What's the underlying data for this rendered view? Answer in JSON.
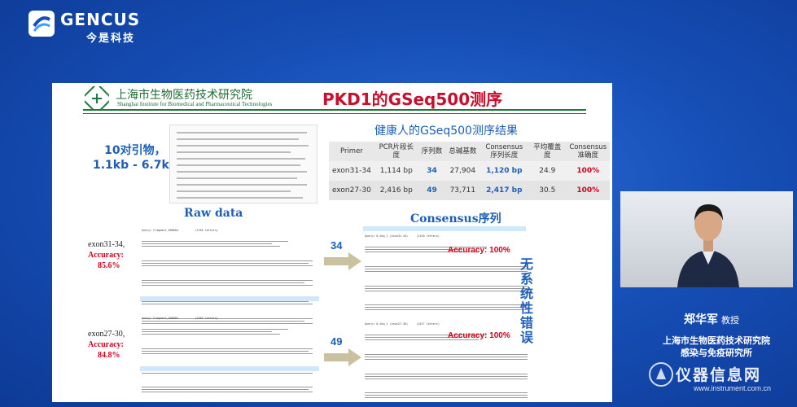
{
  "brand": {
    "name": "GENCUS",
    "sub": "今是科技"
  },
  "slide": {
    "institute_cn": "上海市生物医药技术研究院",
    "institute_en": "Shanghai Institute for Biomedical and Pharmaceutical Technologies",
    "title": "PKD1的GSeq500测序",
    "primer_text_1": "10对引物，",
    "primer_text_2": "1.1kb - 6.7kb",
    "result_title": "健康人的GSeq500测序结果",
    "table": {
      "headers": [
        "Primer",
        "PCR片段长度",
        "序列数",
        "总碱基数",
        "Consensus序列长度",
        "平均覆盖度",
        "Consensus准确度"
      ],
      "rows": [
        [
          "exon31-34",
          "1,114 bp",
          "34",
          "27,904",
          "1,120 bp",
          "24.9",
          "100%"
        ],
        [
          "exon27-30",
          "2,416 bp",
          "49",
          "73,711",
          "2,417 bp",
          "30.5",
          "100%"
        ]
      ]
    },
    "raw_title": "Raw data",
    "consensus_title": "Consensus序列",
    "exon1": {
      "name": "exon31-34,",
      "acc_label": "Accuracy:",
      "acc_value": "85.6%"
    },
    "exon2": {
      "name": "exon27-30,",
      "acc_label": "Accuracy:",
      "acc_value": "84.8%"
    },
    "arrow1_count": "34",
    "arrow2_count": "49",
    "consensus_acc_1": "Accuracy: 100%",
    "consensus_acc_2": "Accuracy: 100%",
    "side_note": "无系统性错误",
    "raw1_header": "Query= Fragment_000004          (1156 letters)",
    "raw2_header": "Query= Fragment_000084          (2385 letters)",
    "cons1_header": "Query= 0-Seq_1 (exon31-34)     (1120 letters)",
    "cons2_header": "Query= 0-Seq_1 (exon27-30)     (2417 letters)"
  },
  "speaker": {
    "name": "郑华军",
    "title": "教授",
    "affiliation_1": "上海市生物医药技术研究院",
    "affiliation_2": "感染与免疫研究所"
  },
  "watermark": {
    "cn": "仪器信息网",
    "url": "www.instrument.com.cn"
  },
  "colors": {
    "background": "#1750b8",
    "accent_red": "#d0021b",
    "accent_blue": "#1d5fb8",
    "institute_green": "#1e7a3a"
  }
}
